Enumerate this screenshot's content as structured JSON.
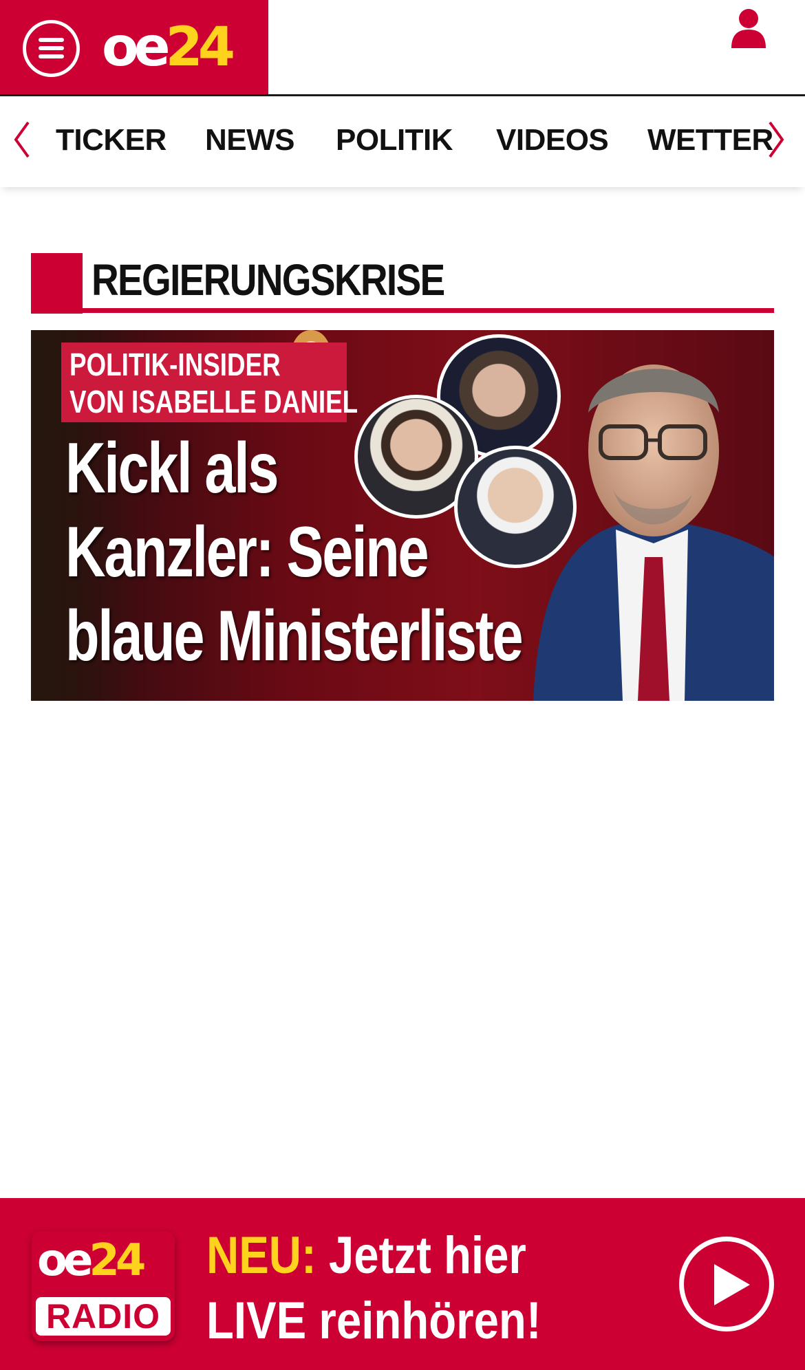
{
  "header": {
    "logo_oe": "oe",
    "logo_num": "24",
    "menu_icon": "hamburger-menu-icon",
    "user_icon": "user-icon"
  },
  "nav": {
    "items": [
      "TICKER",
      "NEWS",
      "POLITIK",
      "VIDEOS",
      "WETTER"
    ],
    "prev_icon": "chevron-left-icon",
    "next_icon": "chevron-right-icon"
  },
  "section": {
    "title": "REGIERUNGSKRISE"
  },
  "teaser": {
    "kicker_line1": "POLITIK-INSIDER",
    "kicker_line2": "VON ISABELLE DANIEL",
    "headline_line1": "Kickl als",
    "headline_line2": "Kanzler: Seine",
    "headline_line3": "blaue Ministerliste"
  },
  "radio": {
    "logo_oe": "oe",
    "logo_num": "24",
    "logo_label": "RADIO",
    "neu": "NEU:",
    "line1_rest": " Jetzt hier",
    "line2": "LIVE reinhören!",
    "play_icon": "play-icon"
  },
  "colors": {
    "brand_red": "#cc0033",
    "brand_yellow": "#ffd21e",
    "text_dark": "#111111"
  }
}
